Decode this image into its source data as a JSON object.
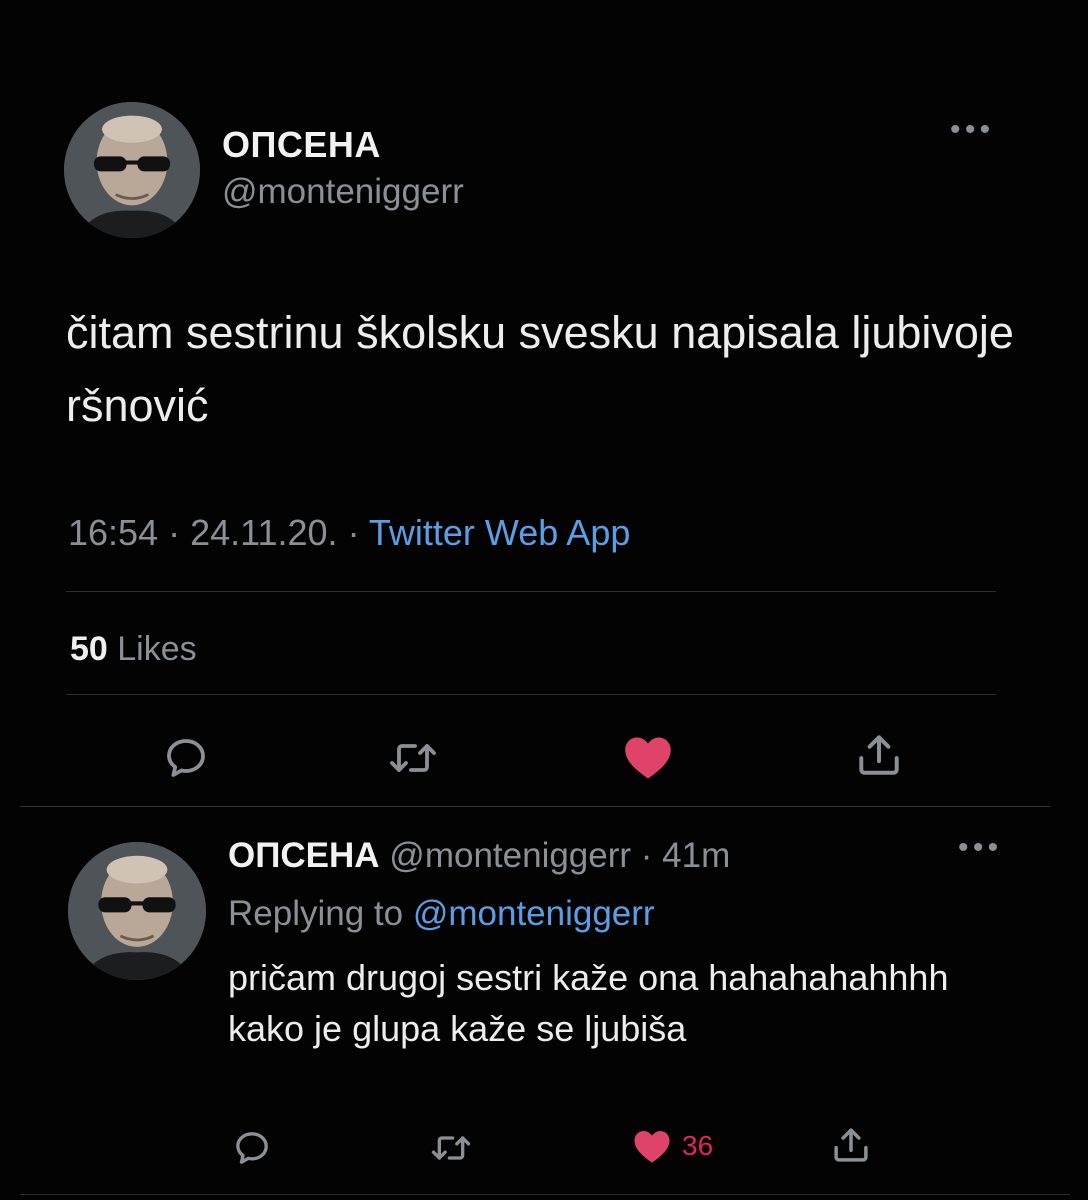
{
  "tweet": {
    "display_name": "ОПСЕНА",
    "handle": "@monteniggerr",
    "text": "čitam sestrinu školsku svesku napisala ljubivoje ršnović",
    "time": "16:54",
    "sep1": " · ",
    "date": "24.11.20.",
    "sep2": " · ",
    "source": "Twitter Web App",
    "likes_count": "50",
    "likes_label": " Likes",
    "liked": true,
    "more_icon": "ellipsis-icon"
  },
  "reply": {
    "display_name": "ОПСЕНА",
    "handle": "@monteniggerr",
    "time_sep": " · ",
    "time": "41m",
    "replying_label": "Replying to ",
    "replying_to": "@monteniggerr",
    "text": "pričam drugoj sestri kaže ona hahahahahhhh kako je glupa kaže se ljubiša",
    "like_count": "36",
    "liked": true,
    "more_icon": "ellipsis-icon"
  },
  "colors": {
    "background": "#030303",
    "secondary_text": "#8b9096",
    "link": "#5c9ee6",
    "like": "#e0245e"
  },
  "icons": [
    "reply-icon",
    "retweet-icon",
    "heart-icon",
    "share-icon"
  ]
}
